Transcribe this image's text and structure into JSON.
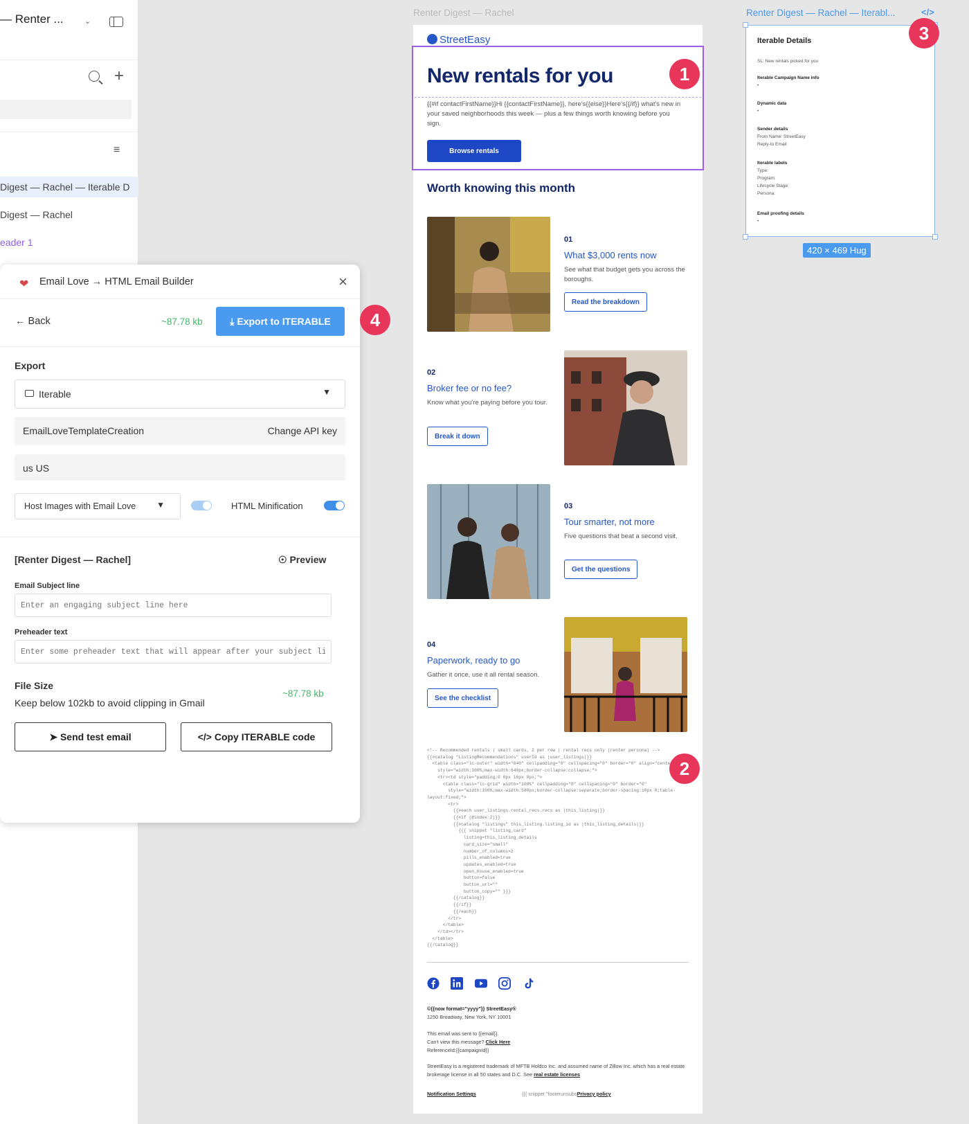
{
  "layers": {
    "title": "— Renter ...",
    "items": [
      "Digest — Rachel — Iterable D",
      "Digest — Rachel",
      "eader 1"
    ]
  },
  "email_love": {
    "title": "Email Love → HTML Email Builder",
    "back": "← Back",
    "size": "~87.78 kb",
    "export_button": "Export to ITERABLE",
    "export_label": "Export",
    "esp": "Iterable",
    "api_name": "EmailLoveTemplateCreation",
    "change_api": "Change API key",
    "region": "us US",
    "host_images": "Host Images with Email Love",
    "minification": "HTML Minification",
    "template_name": "[Renter Digest — Rachel]",
    "preview": "Preview",
    "subject_label": "Email Subject line",
    "subject_placeholder": "Enter an engaging subject line here",
    "preheader_label": "Preheader text",
    "preheader_placeholder": "Enter some preheader text that will appear after your subject line",
    "file_size_label": "File Size",
    "file_size_desc": "Keep below 102kb to avoid clipping in Gmail",
    "file_size_value": "~87.78 kb",
    "send_test": "Send test email",
    "copy_code": "Copy ITERABLE code"
  },
  "badges": [
    "1",
    "2",
    "3",
    "4"
  ],
  "email": {
    "frame_label": "Renter Digest — Rachel",
    "logo": "StreetEasy",
    "hero_title": "New rentals for you",
    "hero_body": "{{#if contactFirstName}}Hi {{contactFirstName}}, here's{{else}}Here's{{/if}} what's new in your saved neighborhoods this week — plus a few things worth knowing before you sign.",
    "browse_button": "Browse rentals",
    "section_title": "Worth knowing this month",
    "cards": [
      {
        "num": "01",
        "title": "What $3,000 rents now",
        "desc": "See what that budget gets you across the boroughs.",
        "button": "Read the breakdown"
      },
      {
        "num": "02",
        "title": "Broker fee or no fee?",
        "desc": "Know what you're paying before you tour.",
        "button": "Break it down"
      },
      {
        "num": "03",
        "title": "Tour smarter, not more",
        "desc": "Five questions that beat a second visit.",
        "button": "Get the questions"
      },
      {
        "num": "04",
        "title": "Paperwork, ready to go",
        "desc": "Gather it once, use it all rental season.",
        "button": "See the checklist"
      }
    ],
    "code_snippet": "<!-- Recommended rentals | small cards, 2 per row | rental recs only (renter persona) -->\n{{#catalog \"ListingRecommendations\" userId as |user_listings|}}\n  <table class=\"lc-outer\" width=\"640\" cellpadding=\"0\" cellspacing=\"0\" border=\"0\" align=\"center\"\n    style=\"width:100%;max-width:640px;border-collapse:collapse;\">\n    <tr><td style=\"padding:0 0px 16px 0px;\">\n      <table class=\"lc-grid\" width=\"100%\" cellpadding=\"0\" cellspacing=\"0\" border=\"0\"\n        style=\"width:100%;max-width:580px;border-collapse:separate;border-spacing:10px 0;table-\nlayout:fixed;\">\n        <tr>\n          {{#each user_listings.rental_recs.recs as |this_listing|}}\n          {{#if (@index 2)}}\n          {{#catalog \"listings\" this_listing.listing_id as |this_listing_details|}}\n            {{{ snippet \"listing_card\"\n              listing=this_listing_details\n              card_size=\"small\"\n              number_of_columns=2\n              pills_enabled=true\n              updates_enabled=true\n              open_house_enabled=true\n              button=false\n              button_url=\"\"\n              button_copy=\"\" }}}\n          {{/catalog}}\n          {{/if}}\n          {{/each}}\n        </tr>\n      </table>\n    </td></tr>\n  </table>\n{{/catalog}}",
    "footer_copy": "©{{now format=\"yyyy\"}} StreetEasy®",
    "footer_address": "1250 Broadway, New York, NY 10001",
    "footer_sent": "This email was sent to {{email}}.",
    "footer_view": "Can't view this message?",
    "footer_view_link": "Click Here",
    "footer_ref": "ReferenceId:{{campaignId}}",
    "footer_legal": "StreetEasy is a registered trademark of MFTB Holdco Inc. and assumed name of Zillow Inc. which has a real estate brokerage license in all 50 states and D.C. See",
    "footer_legal_link": "real estate licenses",
    "footer_notif": "Notification Settings",
    "footer_snippet": "{{{ snippet \"footerunsubs",
    "footer_privacy": "Privacy policy"
  },
  "iterable": {
    "frame_label": "Renter Digest — Rachel — Iterabl...",
    "title": "Iterable Details",
    "sl": "SL: New rentals picked for you",
    "campaign": "Iterable Campaign Name info",
    "dash": "•",
    "dynamic": "Dynamic data",
    "sender": "Sender details",
    "from": "From Name: StreetEasy",
    "reply": "Reply-to Email:",
    "labels": "Iterable labels",
    "type": "Type:",
    "program": "Program:",
    "lifecycle": "Lifecycle Stage:",
    "persona": "Persona:",
    "proofing": "Email proofing details",
    "hug": "420 × 469 Hug"
  },
  "colors": {
    "brand_blue": "#1d47c4",
    "navy": "#13276b",
    "accent": "#4a9af0",
    "badge": "#e8355a",
    "selection": "#9b5ee6",
    "success": "#45b56b"
  }
}
